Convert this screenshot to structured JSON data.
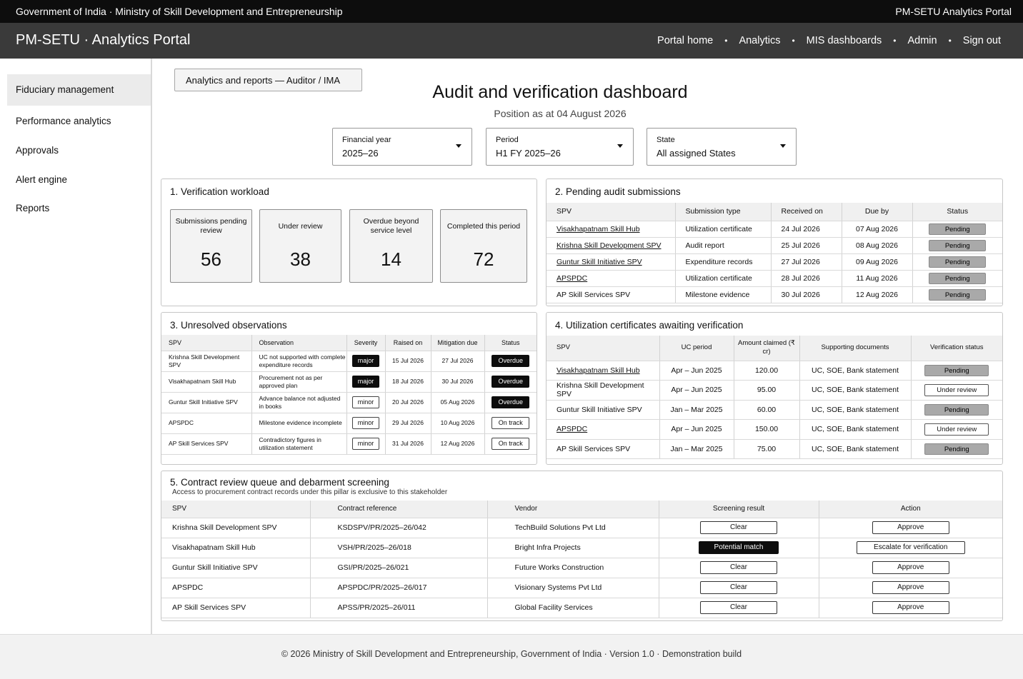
{
  "gov_bar": {
    "left": "Government of India · Ministry of Skill Development and Entrepreneurship",
    "right": "PM-SETU Analytics Portal"
  },
  "app_bar": {
    "brand": "PM-SETU · Analytics Portal",
    "nav": [
      "Portal home",
      "Analytics",
      "MIS dashboards",
      "Admin",
      "Sign out"
    ],
    "separator": "•"
  },
  "sidebar": {
    "items": [
      "Fiduciary management",
      "Performance analytics",
      "Approvals",
      "Alert engine",
      "Reports"
    ],
    "active": "Fiduciary management"
  },
  "breadcrumb": "Analytics and reports — Auditor / IMA",
  "page": {
    "title": "Audit and verification dashboard",
    "subtitle": "Position as at 04 August 2026"
  },
  "filters": [
    {
      "label": "Financial year",
      "value": "2025–26"
    },
    {
      "label": "Period",
      "value": "H1 FY 2025–26"
    },
    {
      "label": "State",
      "value": "All assigned States"
    }
  ],
  "workload": {
    "title": "1.  Verification workload",
    "kpis": [
      {
        "label": "Submissions pending review",
        "value": "56"
      },
      {
        "label": "Under review",
        "value": "38"
      },
      {
        "label": "Overdue beyond service level",
        "value": "14"
      },
      {
        "label": "Completed this period",
        "value": "72"
      }
    ]
  },
  "pending_audit": {
    "title": "2.  Pending audit submissions",
    "headers": [
      "SPV",
      "Submission type",
      "Received on",
      "Due by",
      "Status"
    ],
    "rows": [
      {
        "spv": "Visakhapatnam Skill Hub",
        "type": "Utilization certificate",
        "received": "24 Jul 2026",
        "due": "07 Aug 2026",
        "status": "Pending"
      },
      {
        "spv": "Krishna Skill Development SPV",
        "type": "Audit report",
        "received": "25 Jul 2026",
        "due": "08 Aug 2026",
        "status": "Pending"
      },
      {
        "spv": "Guntur Skill Initiative SPV",
        "type": "Expenditure records",
        "received": "27 Jul 2026",
        "due": "09 Aug 2026",
        "status": "Pending"
      },
      {
        "spv": "APSPDC",
        "type": "Utilization certificate",
        "received": "28 Jul 2026",
        "due": "11 Aug 2026",
        "status": "Pending"
      },
      {
        "spv": "AP Skill Services SPV",
        "type": "Milestone evidence",
        "received": "30 Jul 2026",
        "due": "12 Aug 2026",
        "status": "Pending"
      }
    ]
  },
  "observations": {
    "title": "3.  Unresolved observations",
    "headers": [
      "SPV",
      "Observation",
      "Severity",
      "Raised on",
      "Mitigation due",
      "Status"
    ],
    "rows": [
      {
        "spv": "Krishna Skill Development SPV",
        "obs": "UC not supported with complete expenditure records",
        "sev": "major",
        "raised": "15 Jul 2026",
        "due": "27 Jul 2026",
        "status": "Overdue"
      },
      {
        "spv": "Visakhapatnam Skill Hub",
        "obs": "Procurement not as per approved plan",
        "sev": "major",
        "raised": "18 Jul 2026",
        "due": "30 Jul 2026",
        "status": "Overdue"
      },
      {
        "spv": "Guntur Skill Initiative SPV",
        "obs": "Advance balance not adjusted in books",
        "sev": "minor",
        "raised": "20 Jul 2026",
        "due": "05 Aug 2026",
        "status": "Overdue"
      },
      {
        "spv": "APSPDC",
        "obs": "Milestone evidence incomplete",
        "sev": "minor",
        "raised": "29 Jul 2026",
        "due": "10 Aug 2026",
        "status": "On track"
      },
      {
        "spv": "AP Skill Services SPV",
        "obs": "Contradictory figures in utilization statement",
        "sev": "minor",
        "raised": "31 Jul 2026",
        "due": "12 Aug 2026",
        "status": "On track"
      }
    ]
  },
  "uc": {
    "title": "4.  Utilization certificates awaiting verification",
    "headers": [
      "SPV",
      "UC period",
      "Amount claimed (₹ cr)",
      "Supporting documents",
      "Verification status"
    ],
    "rows": [
      {
        "spv": "Visakhapatnam Skill Hub",
        "period": "Apr – Jun 2025",
        "amount": "120.00",
        "docs": "UC, SOE, Bank statement",
        "status": "Pending",
        "linked": true
      },
      {
        "spv": "Krishna Skill Development SPV",
        "period": "Apr – Jun 2025",
        "amount": "95.00",
        "docs": "UC, SOE, Bank statement",
        "status": "Under review",
        "linked": false
      },
      {
        "spv": "Guntur Skill Initiative SPV",
        "period": "Jan – Mar 2025",
        "amount": "60.00",
        "docs": "UC, SOE, Bank statement",
        "status": "Pending",
        "linked": false
      },
      {
        "spv": "APSPDC",
        "period": "Apr – Jun 2025",
        "amount": "150.00",
        "docs": "UC, SOE, Bank statement",
        "status": "Under review",
        "linked": true
      },
      {
        "spv": "AP Skill Services SPV",
        "period": "Jan – Mar 2025",
        "amount": "75.00",
        "docs": "UC, SOE, Bank statement",
        "status": "Pending",
        "linked": false
      }
    ]
  },
  "contracts": {
    "title": "5.  Contract review queue and debarment screening",
    "note": "Access to procurement contract records under this pillar is exclusive to this stakeholder",
    "headers": [
      "SPV",
      "Contract reference",
      "Vendor",
      "Screening result",
      "Action"
    ],
    "rows": [
      {
        "spv": "Krishna Skill Development SPV",
        "ref": "KSDSPV/PR/2025–26/042",
        "vendor": "TechBuild Solutions Pvt Ltd",
        "result": "Clear",
        "action": "Approve"
      },
      {
        "spv": "Visakhapatnam Skill Hub",
        "ref": "VSH/PR/2025–26/018",
        "vendor": "Bright Infra Projects",
        "result": "Potential match",
        "action": "Escalate for verification"
      },
      {
        "spv": "Guntur Skill Initiative SPV",
        "ref": "GSI/PR/2025–26/021",
        "vendor": "Future Works Construction",
        "result": "Clear",
        "action": "Approve"
      },
      {
        "spv": "APSPDC",
        "ref": "APSPDC/PR/2025–26/017",
        "vendor": "Visionary Systems Pvt Ltd",
        "result": "Clear",
        "action": "Approve"
      },
      {
        "spv": "AP Skill Services SPV",
        "ref": "APSS/PR/2025–26/011",
        "vendor": "Global Facility Services",
        "result": "Clear",
        "action": "Approve"
      }
    ]
  },
  "footer": "© 2026 Ministry of Skill Development and Entrepreneurship, Government of India  ·  Version 1.0  ·  Demonstration build"
}
